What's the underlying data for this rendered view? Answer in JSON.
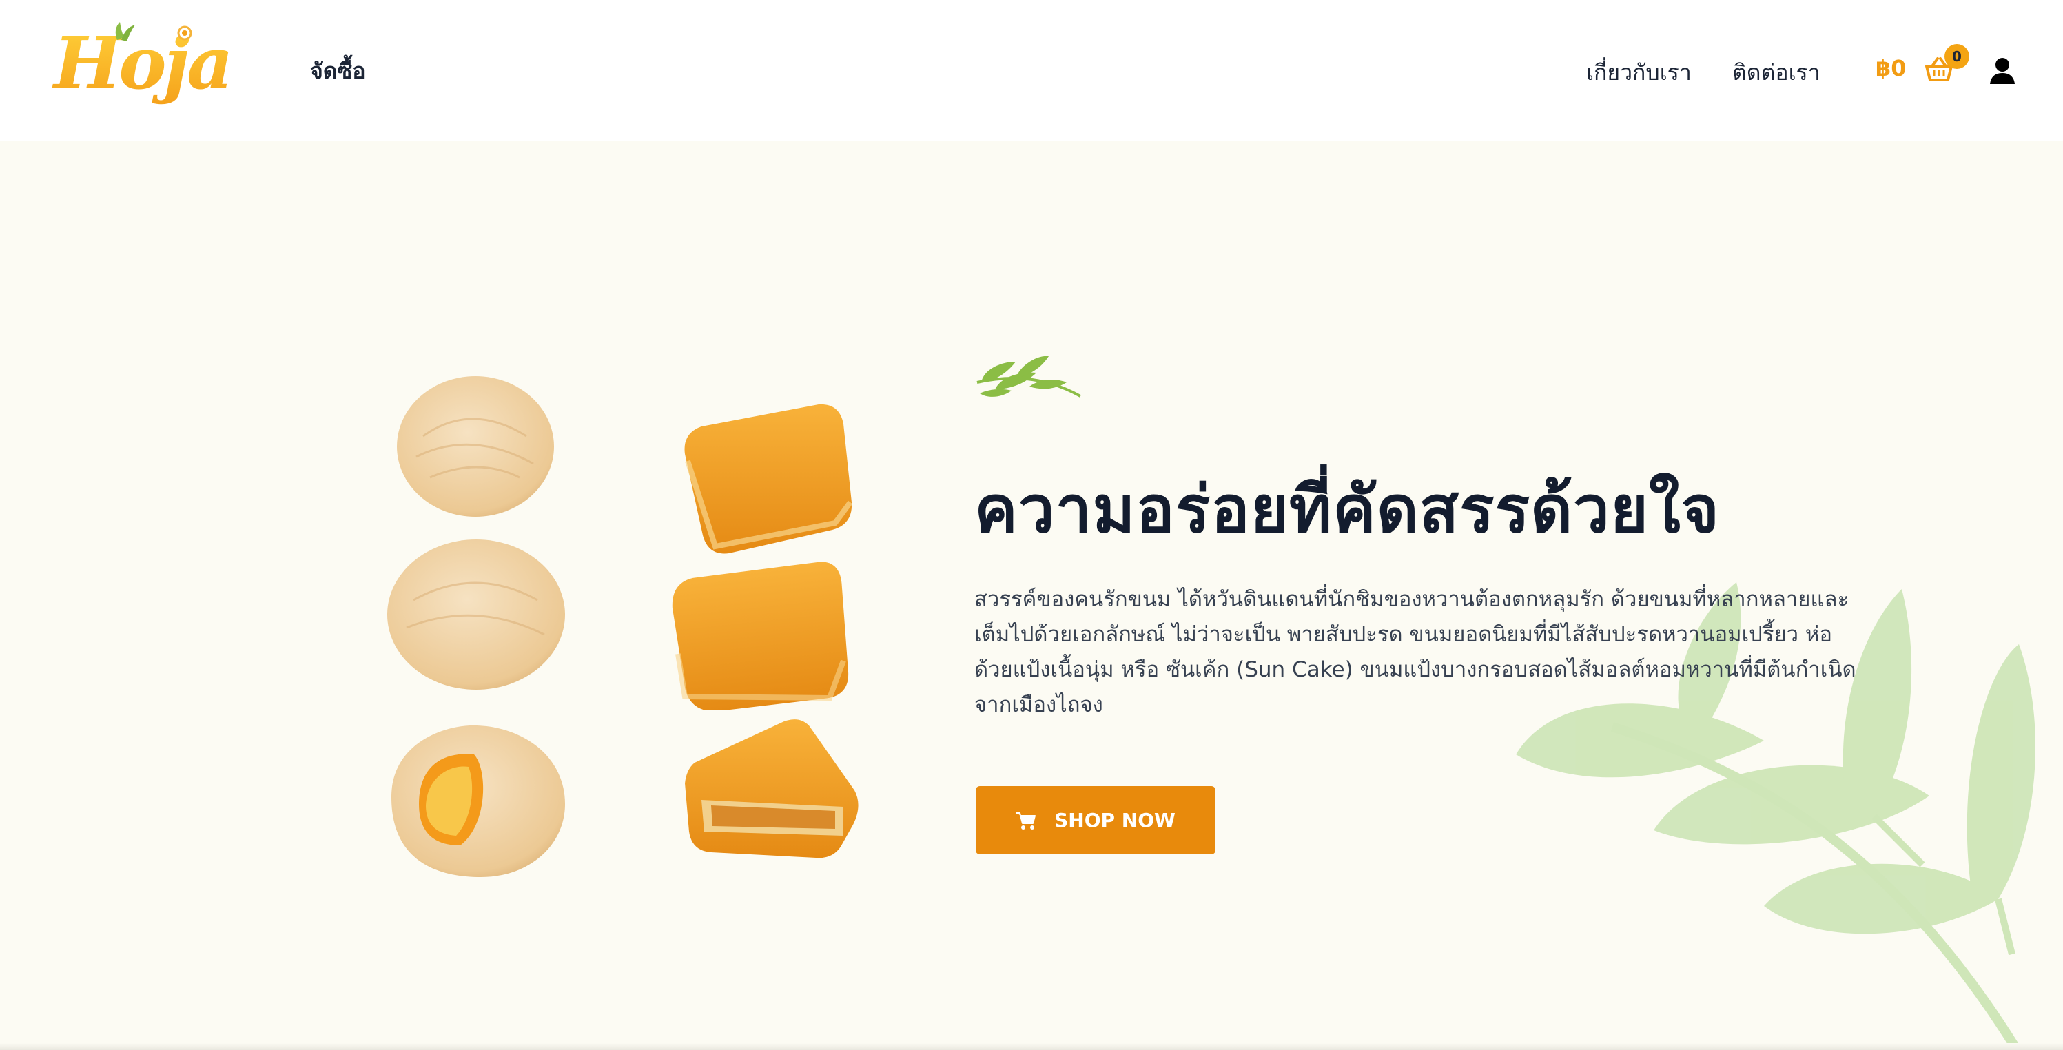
{
  "header": {
    "logo_text": "Hoja",
    "nav_shop": "จัดซื้อ",
    "nav_about": "เกี่ยวกับเรา",
    "nav_contact": "ติดต่อเรา",
    "cart_total": "฿0",
    "cart_count": "0",
    "icons": {
      "cart": "basket-icon",
      "account": "user-icon"
    }
  },
  "hero": {
    "title": "ความอร่อยที่คัดสรรด้วยใจ",
    "description": "สวรรค์ของคนรักขนม ได้หวันดินแดนที่นักชิมของหวานต้องตกหลุมรัก ด้วยขนมที่หลากหลายและเต็มไปด้วยเอกลักษณ์ ไม่ว่าจะเป็น พายสับปะรด ขนมยอดนิยมที่มีไส้สับปะรดหวานอมเปรี้ยว ห่อด้วยแป้งเนื้อนุ่ม หรือ ซันเค้ก (Sun Cake) ขนมแป้งบางกรอบสอดไส้มอลต์หอมหวานที่มีต้นกำเนิดจากเมืองไถจง",
    "cta_label": "SHOP NOW",
    "cta_icon": "cart-icon"
  },
  "colors": {
    "accent": "#e88a0c",
    "price": "#f29c13",
    "hero_bg": "#fcfbf3",
    "leaf": "#cfe6b8"
  }
}
